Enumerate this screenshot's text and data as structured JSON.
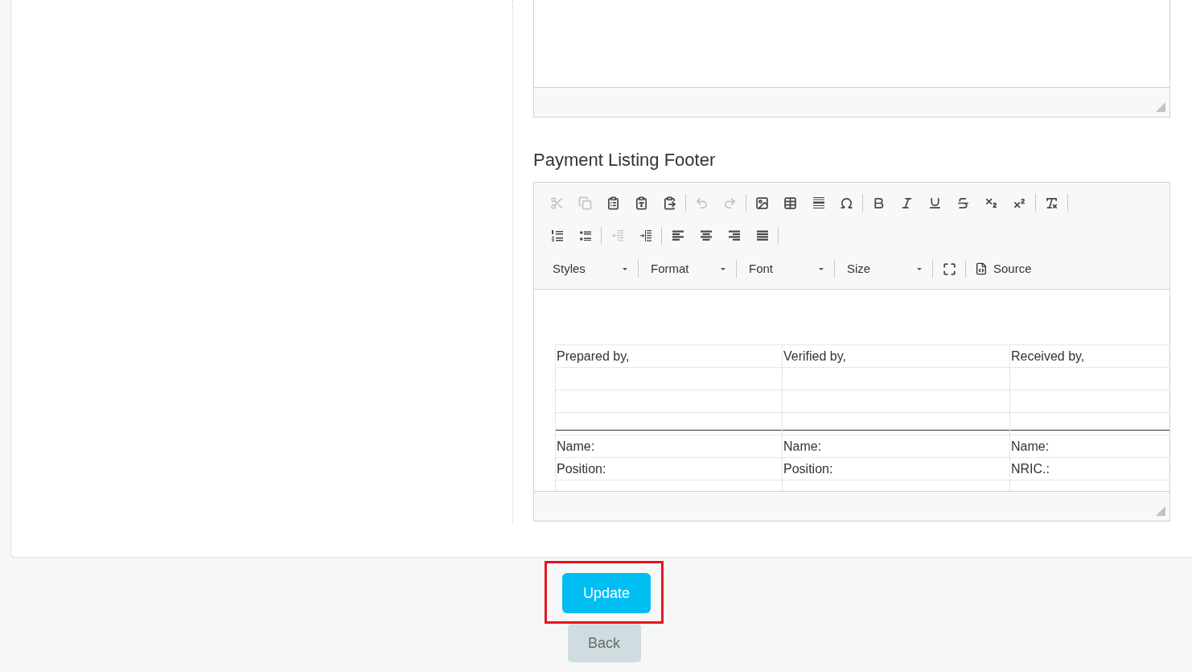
{
  "payment_listing_footer": {
    "title": "Payment Listing Footer",
    "toolbar": {
      "rows": [
        {
          "groups": [
            {
              "buttons": [
                {
                  "disabled": true
                },
                {
                  "disabled": true
                },
                {
                  "disabled": false
                },
                {
                  "disabled": false
                },
                {
                  "disabled": false
                }
              ]
            },
            {
              "buttons": [
                {
                  "disabled": true
                },
                {
                  "disabled": true
                }
              ]
            },
            {
              "buttons": [
                {
                  "disabled": false
                },
                {
                  "disabled": false
                },
                {
                  "disabled": false
                },
                {
                  "disabled": false
                }
              ]
            },
            {
              "buttons": [
                {
                  "disabled": false
                },
                {
                  "disabled": false
                },
                {
                  "disabled": false
                },
                {
                  "disabled": false
                },
                {
                  "disabled": false
                },
                {
                  "disabled": false
                }
              ]
            },
            {
              "buttons": [
                {
                  "disabled": false
                }
              ]
            }
          ]
        },
        {
          "groups": [
            {
              "buttons": [
                {
                  "disabled": false
                },
                {
                  "disabled": false
                }
              ]
            },
            {
              "buttons": [
                {
                  "disabled": true
                },
                {
                  "disabled": false
                }
              ]
            },
            {
              "buttons": [
                {
                  "disabled": false
                },
                {
                  "disabled": false
                },
                {
                  "disabled": false
                },
                {
                  "disabled": false
                }
              ]
            }
          ]
        }
      ],
      "dropdowns": [
        {
          "label": "Styles"
        },
        {
          "label": "Format"
        },
        {
          "label": "Font"
        },
        {
          "label": "Size"
        }
      ],
      "maximize_button": {
        "disabled": false
      },
      "source_button": {
        "label": "Source"
      }
    },
    "signatories": [
      {
        "heading": "Prepared by,",
        "fields": [
          "Name:",
          "Position:"
        ]
      },
      {
        "heading": "Verified by,",
        "fields": [
          "Name:",
          "Position:"
        ]
      },
      {
        "heading": "Received by,",
        "fields": [
          "Name:",
          "NRIC.:"
        ]
      }
    ]
  },
  "buttons": [
    {
      "label": "Update",
      "kind": "primary",
      "highlighted": true
    },
    {
      "label": "Back",
      "kind": "secondary",
      "highlighted": false
    }
  ]
}
